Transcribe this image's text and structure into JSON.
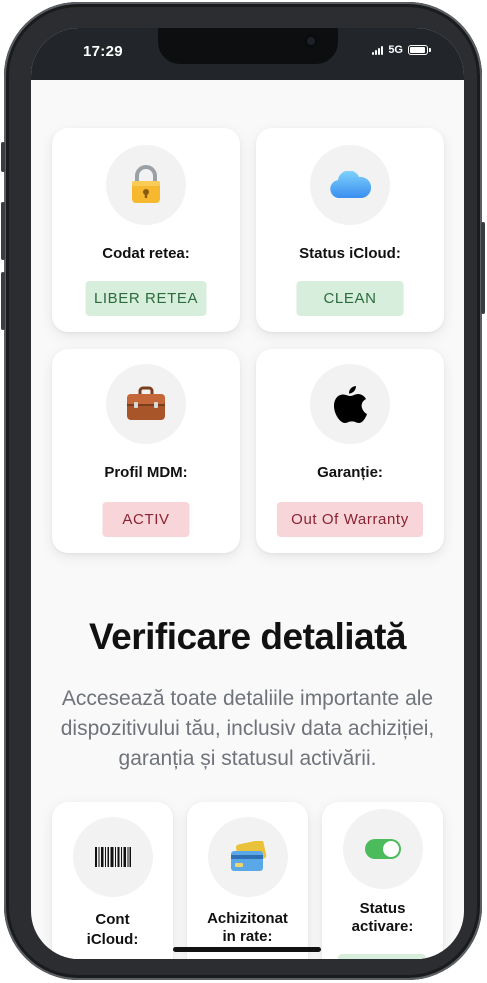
{
  "statusbar": {
    "time": "17:29",
    "network": "5G"
  },
  "cards": [
    {
      "label": "Codat retea:",
      "badge": "LIBER RETEA",
      "badge_color": "green",
      "icon": "padlock-icon"
    },
    {
      "label": "Status iCloud:",
      "badge": "CLEAN",
      "badge_color": "green",
      "icon": "cloud-icon"
    },
    {
      "label": "Profil MDM:",
      "badge": "ACTIV",
      "badge_color": "red",
      "icon": "briefcase-icon"
    },
    {
      "label": "Garanție:",
      "badge": "Out Of Warranty",
      "badge_color": "red",
      "icon": "apple-logo-icon"
    }
  ],
  "section": {
    "title": "Verificare detaliată",
    "description": "Accesează toate detaliile importante ale dispozitivului tău, inclusiv data achiziției, garanția și statusul activării."
  },
  "small_cards": [
    {
      "label_line1": "Cont",
      "label_line2": "iCloud:",
      "icon": "barcode-icon"
    },
    {
      "label_line1": "Achizitonat",
      "label_line2": "in rate:",
      "icon": "credit-card-icon"
    },
    {
      "label_line1": "Status",
      "label_line2": "activare:",
      "icon": "toggle-on-icon"
    }
  ],
  "colors": {
    "badge_green_bg": "#d6eedb",
    "badge_green_text": "#2c6b3c",
    "badge_red_bg": "#f7d5d8",
    "badge_red_text": "#8a2331",
    "toggle_green": "#4cbb5b"
  }
}
